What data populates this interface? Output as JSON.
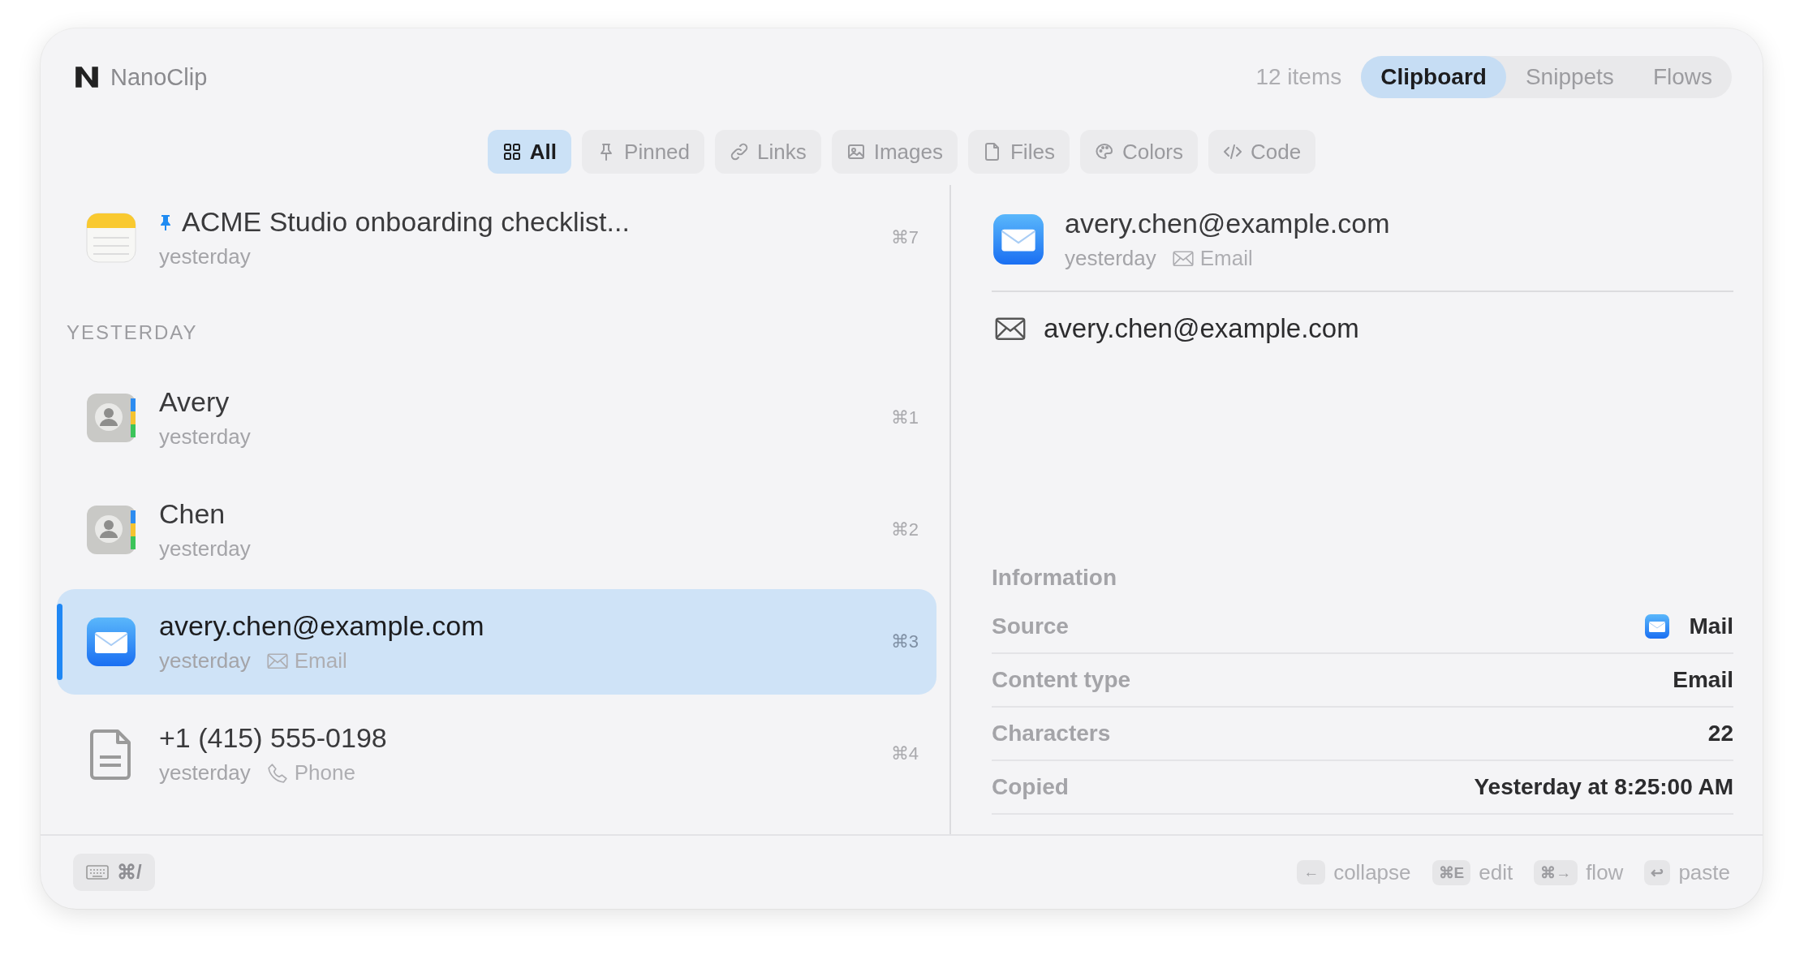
{
  "app": {
    "name": "NanoClip",
    "count": "12 items"
  },
  "modes": [
    {
      "label": "Clipboard",
      "selected": true
    },
    {
      "label": "Snippets",
      "selected": false
    },
    {
      "label": "Flows",
      "selected": false
    }
  ],
  "filters": [
    {
      "kind": "grid",
      "label": "All",
      "selected": true
    },
    {
      "kind": "pin",
      "label": "Pinned",
      "selected": false
    },
    {
      "kind": "link",
      "label": "Links",
      "selected": false
    },
    {
      "kind": "image",
      "label": "Images",
      "selected": false
    },
    {
      "kind": "file",
      "label": "Files",
      "selected": false
    },
    {
      "kind": "palette",
      "label": "Colors",
      "selected": false
    },
    {
      "kind": "code",
      "label": "Code",
      "selected": false
    }
  ],
  "list": [
    {
      "kind": "item",
      "icon": {
        "kind": "notes"
      },
      "title": "ACME Studio onboarding checklist...",
      "time": "yesterday",
      "shortcut": "⌘7",
      "pinned": true,
      "selected": false
    },
    {
      "kind": "section",
      "label": "YESTERDAY"
    },
    {
      "kind": "item",
      "icon": {
        "kind": "contacts"
      },
      "title": "Avery",
      "time": "yesterday",
      "shortcut": "⌘1",
      "pinned": false,
      "selected": false
    },
    {
      "kind": "item",
      "icon": {
        "kind": "contacts"
      },
      "title": "Chen",
      "time": "yesterday",
      "shortcut": "⌘2",
      "pinned": false,
      "selected": false
    },
    {
      "kind": "item",
      "icon": {
        "kind": "mail"
      },
      "title": "avery.chen@example.com",
      "time": "yesterday",
      "type": {
        "kind": "email",
        "label": "Email"
      },
      "shortcut": "⌘3",
      "pinned": false,
      "selected": true
    },
    {
      "kind": "item",
      "icon": {
        "kind": "document"
      },
      "title": "+1 (415) 555-0198",
      "time": "yesterday",
      "type": {
        "kind": "phone",
        "label": "Phone"
      },
      "shortcut": "⌘4",
      "pinned": false,
      "selected": false
    }
  ],
  "detail": {
    "icon": {
      "kind": "mail"
    },
    "title": "avery.chen@example.com",
    "time": "yesterday",
    "type": {
      "kind": "email",
      "label": "Email"
    },
    "content": {
      "kind": "email",
      "text": "avery.chen@example.com"
    },
    "info_title": "Information",
    "info": [
      {
        "label": "Source",
        "value": "Mail",
        "icon": {
          "kind": "mail"
        }
      },
      {
        "label": "Content type",
        "value": "Email"
      },
      {
        "label": "Characters",
        "value": "22"
      },
      {
        "label": "Copied",
        "value": "Yesterday at 8:25:00 AM"
      }
    ]
  },
  "footer": {
    "shortcut": "⌘/",
    "hints": [
      {
        "key": "←",
        "label": "collapse"
      },
      {
        "key": "⌘E",
        "label": "edit"
      },
      {
        "key": "⌘→",
        "label": "flow"
      },
      {
        "key": "↩",
        "label": "paste"
      }
    ]
  }
}
